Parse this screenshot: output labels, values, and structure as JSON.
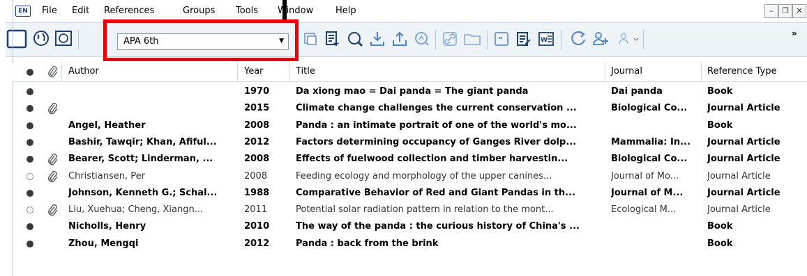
{
  "app": {
    "logo": "EN",
    "menu": [
      "File",
      "Edit",
      "References",
      "Groups",
      "Tools",
      "Window",
      "Help"
    ]
  },
  "toolbar": {
    "output_style": "APA 6th"
  },
  "table": {
    "columns": {
      "author": "Author",
      "year": "Year",
      "title": "Title",
      "journal": "Journal",
      "type": "Reference Type"
    },
    "rows": [
      {
        "read": false,
        "attach": false,
        "author": "",
        "year": "1970",
        "title": "Da xiong mao = Dai panda = The giant panda",
        "journal": "Dai panda",
        "type": "Book"
      },
      {
        "read": false,
        "attach": true,
        "author": "",
        "year": "2015",
        "title": "Climate change challenges the current conservation ...",
        "journal": "Biological Co...",
        "type": "Journal Article"
      },
      {
        "read": false,
        "attach": false,
        "author": "Angel, Heather",
        "year": "2008",
        "title": "Panda : an intimate portrait of one of the world's mo...",
        "journal": "",
        "type": "Book"
      },
      {
        "read": false,
        "attach": false,
        "author": "Bashir, Tawqir; Khan, Afiful...",
        "year": "2012",
        "title": "Factors determining occupancy of Ganges River dolp...",
        "journal": "Mammalia: In...",
        "type": "Journal Article"
      },
      {
        "read": false,
        "attach": true,
        "author": "Bearer, Scott; Linderman, ...",
        "year": "2008",
        "title": "Effects of fuelwood collection and timber harvestin...",
        "journal": "Biological Co...",
        "type": "Journal Article"
      },
      {
        "read": true,
        "attach": true,
        "author": "Christiansen, Per",
        "year": "2008",
        "title": "Feeding ecology and morphology of the upper canines...",
        "journal": "Journal of Mo...",
        "type": "Journal Article"
      },
      {
        "read": false,
        "attach": false,
        "author": "Johnson, Kenneth G.; Schal...",
        "year": "1988",
        "title": "Comparative Behavior of Red and Giant Pandas in th...",
        "journal": "Journal of M...",
        "type": "Journal Article"
      },
      {
        "read": true,
        "attach": true,
        "author": "Liu, Xuehua; Cheng, Xiangn...",
        "year": "2011",
        "title": "Potential solar radiation pattern in relation to the mont...",
        "journal": "Ecological M...",
        "type": "Journal Article"
      },
      {
        "read": false,
        "attach": false,
        "author": "Nicholls, Henry",
        "year": "2010",
        "title": "The way of the panda : the curious history of China's ...",
        "journal": "",
        "type": "Book"
      },
      {
        "read": false,
        "attach": false,
        "author": "Zhou, Mengqi",
        "year": "2012",
        "title": "Panda : back from the brink",
        "journal": "",
        "type": "Book"
      }
    ]
  }
}
